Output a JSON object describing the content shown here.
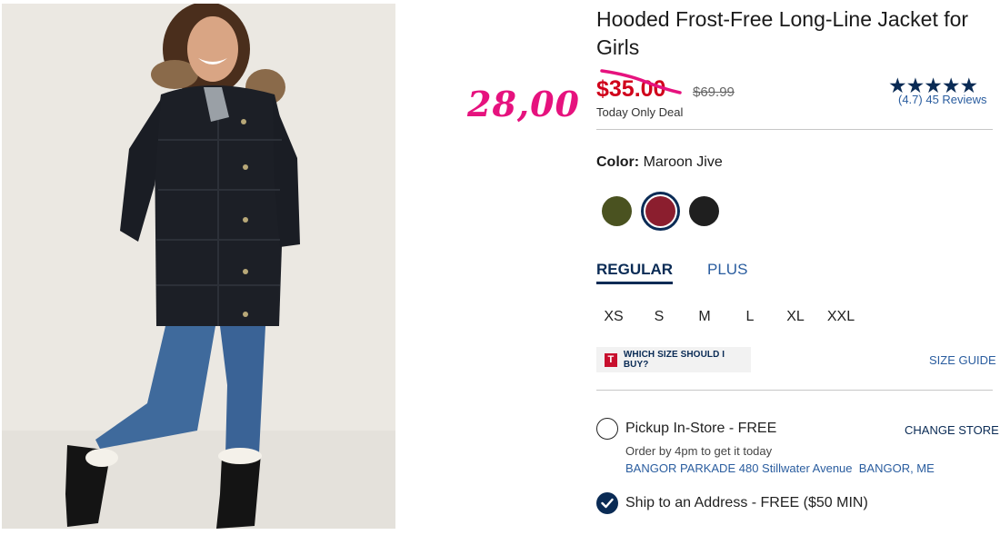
{
  "product": {
    "title": "Hooded Frost-Free Long-Line Jacket for Girls",
    "sale_price": "$35.00",
    "original_price": "$69.99",
    "deal_text": "Today Only Deal",
    "rating_stars": "★★★★★",
    "rating_text": "(4.7) 45 Reviews",
    "rating_value": 4.7
  },
  "annotation": {
    "handwritten_price": "28,00",
    "color": "#e6127e"
  },
  "color_selector": {
    "label": "Color:",
    "selected": "Maroon Jive",
    "swatches": [
      {
        "color": "#4a5220"
      },
      {
        "color": "#8b1e2e",
        "selected": true
      },
      {
        "color": "#1f1f1f"
      }
    ]
  },
  "fit_tabs": {
    "regular": "REGULAR",
    "plus": "PLUS",
    "active": "REGULAR"
  },
  "sizes": [
    "XS",
    "S",
    "M",
    "L",
    "XL",
    "XXL"
  ],
  "size_help": {
    "icon_letter": "T",
    "which_size": "WHICH SIZE SHOULD I BUY?",
    "size_guide": "SIZE GUIDE"
  },
  "fulfillment": {
    "pickup_label": "Pickup In-Store - FREE",
    "change_store": "CHANGE STORE",
    "order_by": "Order by 4pm to get it today",
    "store_address": "BANGOR PARKADE 480 Stillwater Avenue  BANGOR, ME",
    "ship_label": "Ship to an Address - FREE ($50 MIN)"
  },
  "colors": {
    "navy": "#0a2b55",
    "sale_red": "#d0021b",
    "link_blue": "#2a5d9f"
  }
}
